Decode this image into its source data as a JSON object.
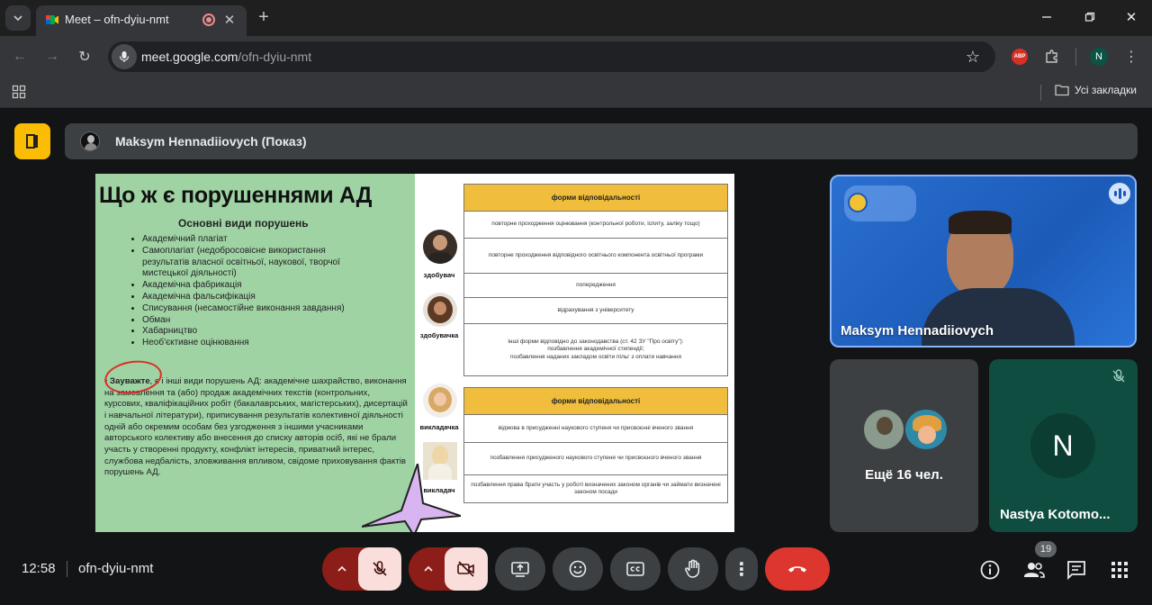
{
  "browser": {
    "tab_title": "Meet – ofn-dyiu-nmt",
    "url_host": "meet.google.com",
    "url_path": "/ofn-dyiu-nmt",
    "abp_badge": "ABP",
    "profile_initial": "N",
    "bookmarks_label": "Усі закладки"
  },
  "meet": {
    "presenter_label": "Maksym Hennadiiovych (Показ)",
    "main_tile_name": "Maksym Hennadiiovych",
    "others_label": "Ещё 16 чел.",
    "nastya_initial": "N",
    "nastya_name": "Nastya Kotomo...",
    "time": "12:58",
    "meeting_code": "ofn-dyiu-nmt",
    "participants_count": "19",
    "accent_red": "#ea4335"
  },
  "slide": {
    "title": "Що ж є порушеннями АД",
    "subtitle": "Основні види порушень",
    "bullets": [
      "Академічний плагіат",
      "Самоплагіат (недобросовісне використання результатів власної освітньої, наукової, творчої мистецької діяльності)",
      "Академічна фабрикація",
      "Академічна фальсифікація",
      "Списування (несамостійне виконання завдання)",
      "Обман",
      "Хабарництво",
      "Необ'єктивне оцінювання"
    ],
    "note_bold": "Зауважте",
    "note_text": ", є і інші види порушень АД: академічне шахрайство, виконання на замовлення та (або) продаж академічних текстів (контрольних, курсових, кваліфікаційних робіт (бакалаврських, магістерських), дисертацій і навчальної літератури), приписування результатів колективної діяльності одній або окремим особам без узгодження з іншими учасниками авторського колективу або внесення до списку авторів осіб, які не брали участь у створенні продукту, конфлікт інтересів, приватний інтерес, службова недбалість, зловживання впливом, свідоме приховування фактів порушень АД.",
    "roles": [
      "здобувач",
      "здобувачка",
      "викладачка",
      "викладач"
    ],
    "table1": {
      "header": "форми відповідальності",
      "rows": [
        "повторне проходження оцінювання (контрольної роботи, іспиту, заліку тощо)",
        "повторне проходження відповідного освітнього компонента освітньої програми",
        "попередження",
        "відрахування з університету",
        "інші форми відповідно до законодавства (ст. 42 ЗУ \"Про освіту\"):\nпозбавлення академічної стипендії;\nпозбавлення наданих закладом освіти пільг з оплати навчання"
      ]
    },
    "table2": {
      "header": "форми відповідальності",
      "rows": [
        "відмова в присудженні наукового ступеня чи присвоєнні вченого звання",
        "позбавлення присудженого наукового ступеня чи присвоєного вченого звання",
        "позбавлення права брати участь у роботі визначених законом органів чи займати визначені законом посади"
      ]
    }
  }
}
